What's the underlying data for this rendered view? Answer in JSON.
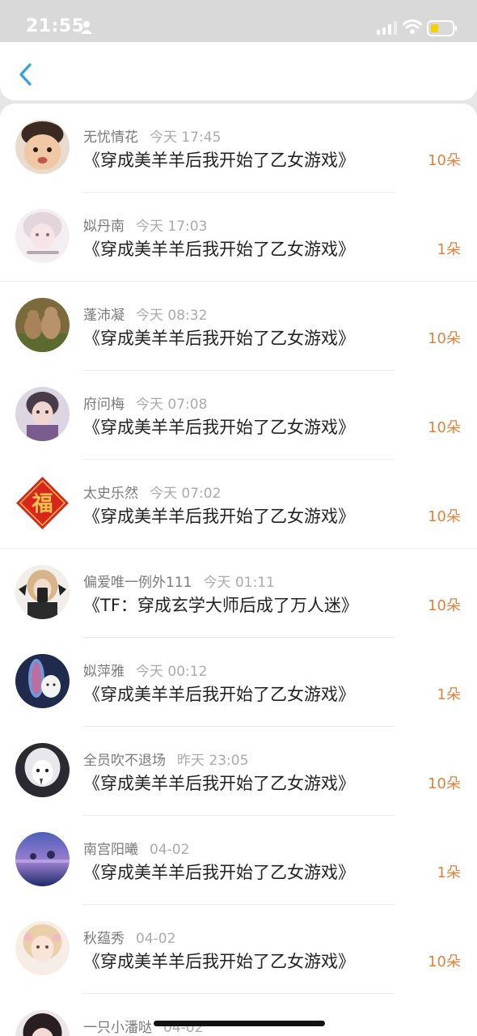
{
  "status": {
    "time": "21:55",
    "icons": [
      "person-icon",
      "signal-icon",
      "wifi-icon",
      "battery-icon"
    ]
  },
  "nav": {
    "back_icon": "chevron-left-icon"
  },
  "colors": {
    "accent": "#e0813c",
    "back_arrow": "#3a9fe0",
    "title": "#222222",
    "meta": "#8a8a8a"
  },
  "rows": [
    {
      "name": "无忧情花",
      "time": "今天 17:45",
      "title": "《穿成美羊羊后我开始了乙女游戏》",
      "count": "10朵"
    },
    {
      "name": "姒丹南",
      "time": "今天 17:03",
      "title": "《穿成美羊羊后我开始了乙女游戏》",
      "count": "1朵"
    },
    {
      "name": "蓬沛凝",
      "time": "今天 08:32",
      "title": "《穿成美羊羊后我开始了乙女游戏》",
      "count": "10朵"
    },
    {
      "name": "府问梅",
      "time": "今天 07:08",
      "title": "《穿成美羊羊后我开始了乙女游戏》",
      "count": "10朵"
    },
    {
      "name": "太史乐然",
      "time": "今天 07:02",
      "title": "《穿成美羊羊后我开始了乙女游戏》",
      "count": "10朵"
    },
    {
      "name": "偏爱唯一例外111",
      "time": "今天 01:11",
      "title": "《TF：穿成玄学大师后成了万人迷》",
      "count": "10朵"
    },
    {
      "name": "姒萍雅",
      "time": "今天 00:12",
      "title": "《穿成美羊羊后我开始了乙女游戏》",
      "count": "1朵"
    },
    {
      "name": "全员吹不退场",
      "time": "昨天 23:05",
      "title": "《穿成美羊羊后我开始了乙女游戏》",
      "count": "10朵"
    },
    {
      "name": "南宫阳曦",
      "time": "04-02",
      "title": "《穿成美羊羊后我开始了乙女游戏》",
      "count": "1朵"
    },
    {
      "name": "秋蕴秀",
      "time": "04-02",
      "title": "《穿成美羊羊后我开始了乙女游戏》",
      "count": "10朵"
    },
    {
      "name": "一只小潘哒",
      "time": "04-02",
      "title": "",
      "count": ""
    }
  ],
  "avatar_text": {
    "fu": "福"
  }
}
